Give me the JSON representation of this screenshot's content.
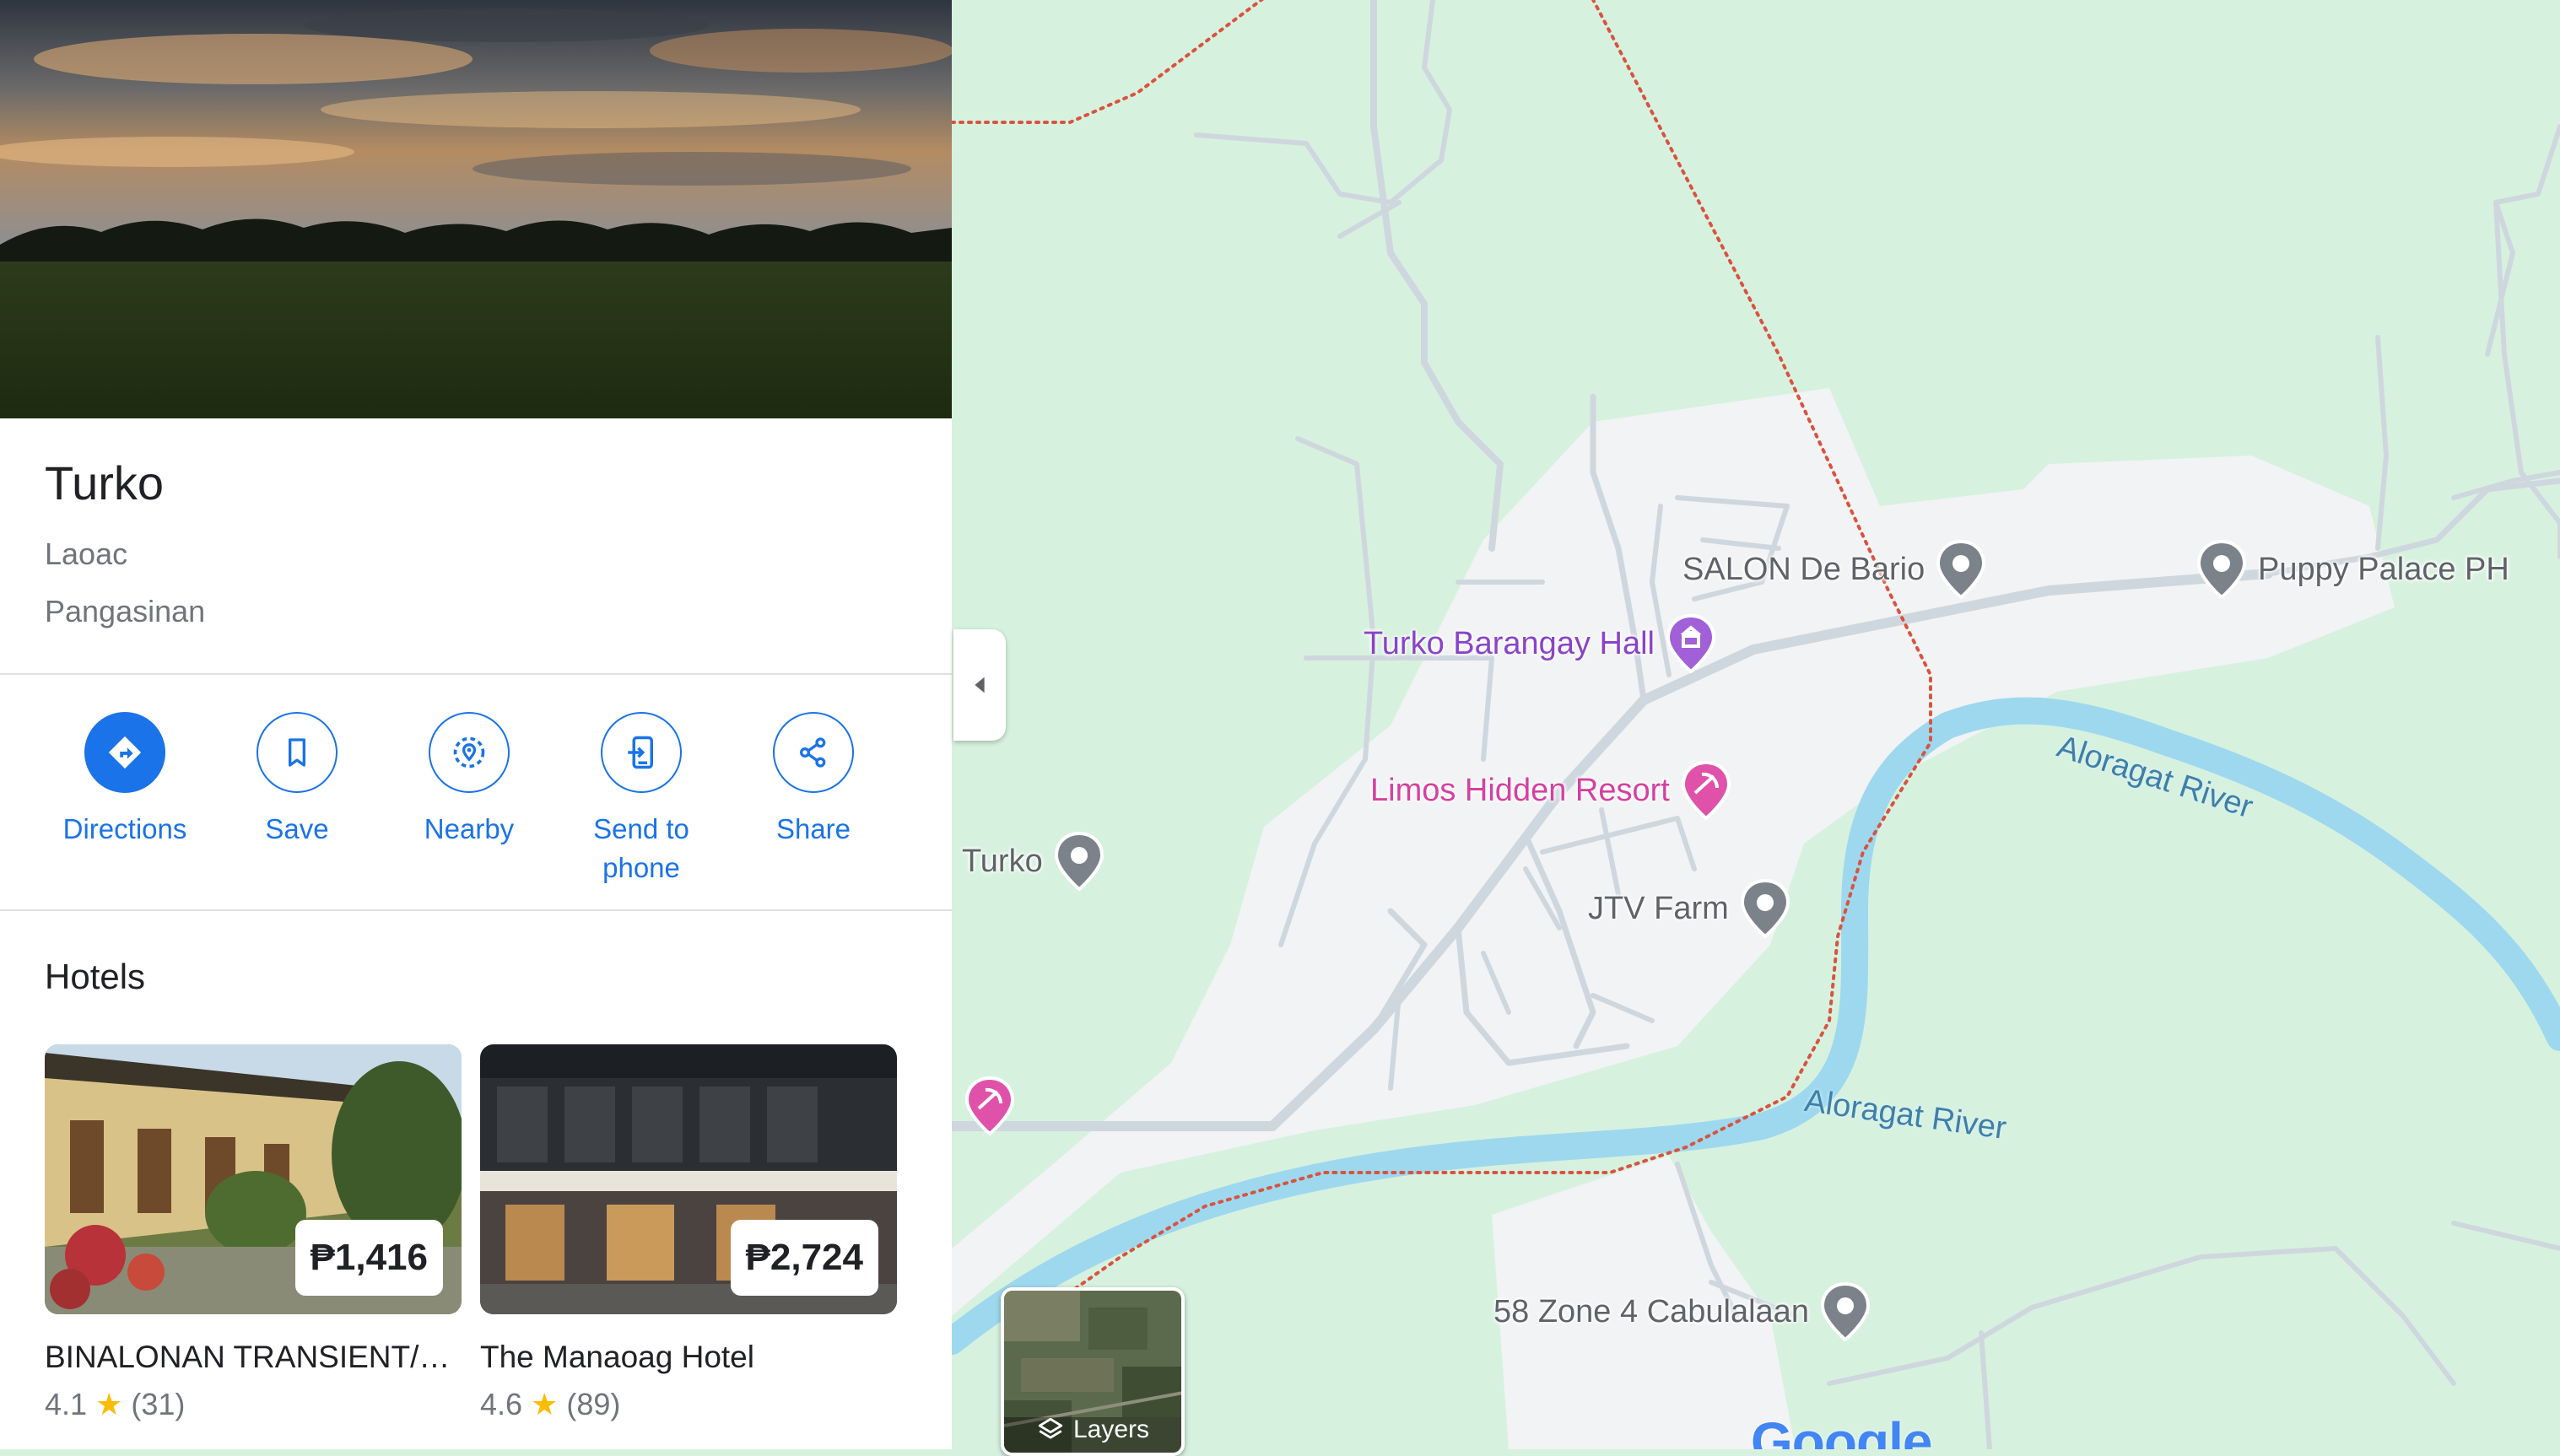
{
  "place": {
    "title": "Turko",
    "locality": "Laoac",
    "province": "Pangasinan"
  },
  "actions": [
    {
      "label": "Directions",
      "icon": "directions-icon",
      "filled": true
    },
    {
      "label": "Save",
      "icon": "bookmark-icon",
      "filled": false
    },
    {
      "label": "Nearby",
      "icon": "nearby-icon",
      "filled": false
    },
    {
      "label": "Send to phone",
      "icon": "send-to-phone-icon",
      "filled": false
    },
    {
      "label": "Share",
      "icon": "share-icon",
      "filled": false
    }
  ],
  "hotels": {
    "title": "Hotels",
    "items": [
      {
        "name": "BINALONAN TRANSIENT/…",
        "price": "₱1,416",
        "rating": "4.1",
        "star": "★",
        "reviews": "(31)"
      },
      {
        "name": "The Manaoag Hotel",
        "price": "₱2,724",
        "rating": "4.6",
        "star": "★",
        "reviews": "(89)"
      }
    ]
  },
  "map": {
    "pois": [
      {
        "name": "SALON De Bario",
        "type": "generic"
      },
      {
        "name": "Puppy Palace PH",
        "type": "generic"
      },
      {
        "name": "Turko Barangay Hall",
        "type": "government"
      },
      {
        "name": "Limos Hidden Resort",
        "type": "resort"
      },
      {
        "name": "Turko",
        "type": "generic"
      },
      {
        "name": "JTV Farm",
        "type": "generic"
      },
      {
        "name": "58 Zone 4 Cabulalaan",
        "type": "generic"
      }
    ],
    "rivers": [
      "Aloragat River",
      "Aloragat River"
    ],
    "layers_label": "Layers",
    "logo": "Google"
  },
  "colors": {
    "accent": "#1a73e8",
    "park_green": "#d7f1df",
    "river": "#9ed8ee",
    "government_poi": "#8a43c9",
    "resort_poi": "#d6409f",
    "generic_poi": "#7b8289",
    "boundary": "#d9533f"
  }
}
